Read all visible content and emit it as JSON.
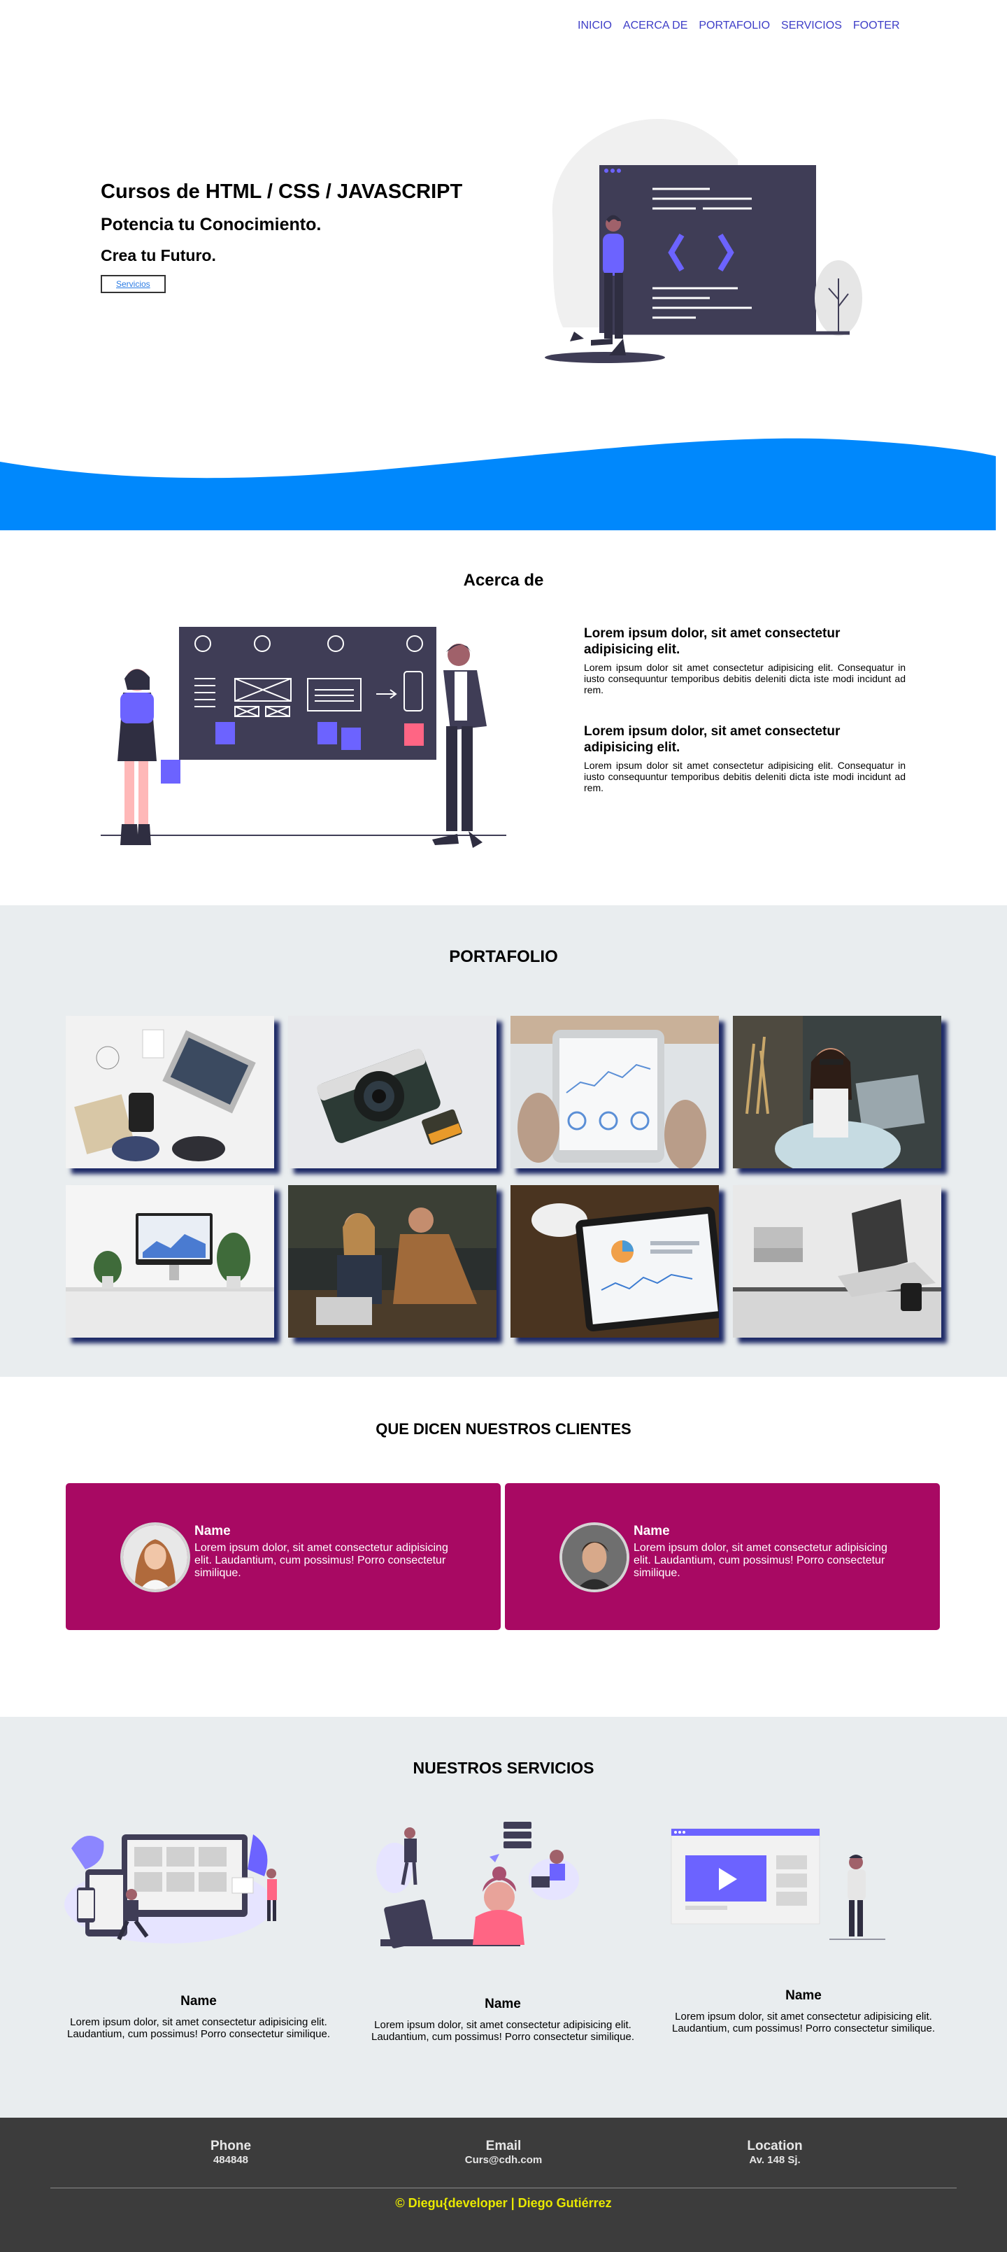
{
  "nav": {
    "items": [
      "INICIO",
      "ACERCA DE",
      "PORTAFOLIO",
      "SERVICIOS",
      "FOOTER"
    ]
  },
  "hero": {
    "title": "Cursos de HTML / CSS / JAVASCRIPT",
    "subtitle": "Potencia tu Conocimiento.",
    "tagline": "Crea tu Futuro.",
    "button_label": "Servicios"
  },
  "about": {
    "title": "Acerca de",
    "blocks": [
      {
        "heading": "Lorem ipsum dolor, sit amet consectetur adipisicing elit.",
        "text": "Lorem ipsum dolor sit amet consectetur adipisicing elit. Consequatur in iusto consequuntur temporibus debitis deleniti dicta iste modi incidunt ad rem."
      },
      {
        "heading": "Lorem ipsum dolor, sit amet consectetur adipisicing elit.",
        "text": "Lorem ipsum dolor sit amet consectetur adipisicing elit. Consequatur in iusto consequuntur temporibus debitis deleniti dicta iste modi incidunt ad rem."
      }
    ]
  },
  "portfolio": {
    "title": "PORTAFOLIO"
  },
  "testimonials": {
    "title": "QUE DICEN NUESTROS CLIENTES",
    "cards": [
      {
        "name": "Name",
        "text": "Lorem ipsum dolor, sit amet consectetur adipisicing elit. Laudantium, cum possimus! Porro consectetur similique."
      },
      {
        "name": "Name",
        "text": "Lorem ipsum dolor, sit amet consectetur adipisicing elit. Laudantium, cum possimus! Porro consectetur similique."
      }
    ]
  },
  "services": {
    "title": "NUESTROS SERVICIOS",
    "items": [
      {
        "name": "Name",
        "text": "Lorem ipsum dolor, sit amet consectetur adipisicing elit. Laudantium, cum possimus! Porro consectetur similique."
      },
      {
        "name": "Name",
        "text": "Lorem ipsum dolor, sit amet consectetur adipisicing elit. Laudantium, cum possimus! Porro consectetur similique."
      },
      {
        "name": "Name",
        "text": "Lorem ipsum dolor, sit amet consectetur adipisicing elit. Laudantium, cum possimus! Porro consectetur similique."
      }
    ]
  },
  "footer": {
    "phone_label": "Phone",
    "phone_value": "484848",
    "email_label": "Email",
    "email_value": "Curs@cdh.com",
    "location_label": "Location",
    "location_value": "Av. 148 Sj.",
    "copyright": "© Diegu{developer | Diego Gutiérrez"
  },
  "colors": {
    "nav_link": "#3d3dc7",
    "wave_blue": "#0088fc",
    "section_gray": "#e9edef",
    "testimonial_card": "#a80963",
    "footer_bg": "#3c3c3c",
    "copyright_yellow": "#e8e800",
    "illustration_purple": "#6c63ff"
  }
}
